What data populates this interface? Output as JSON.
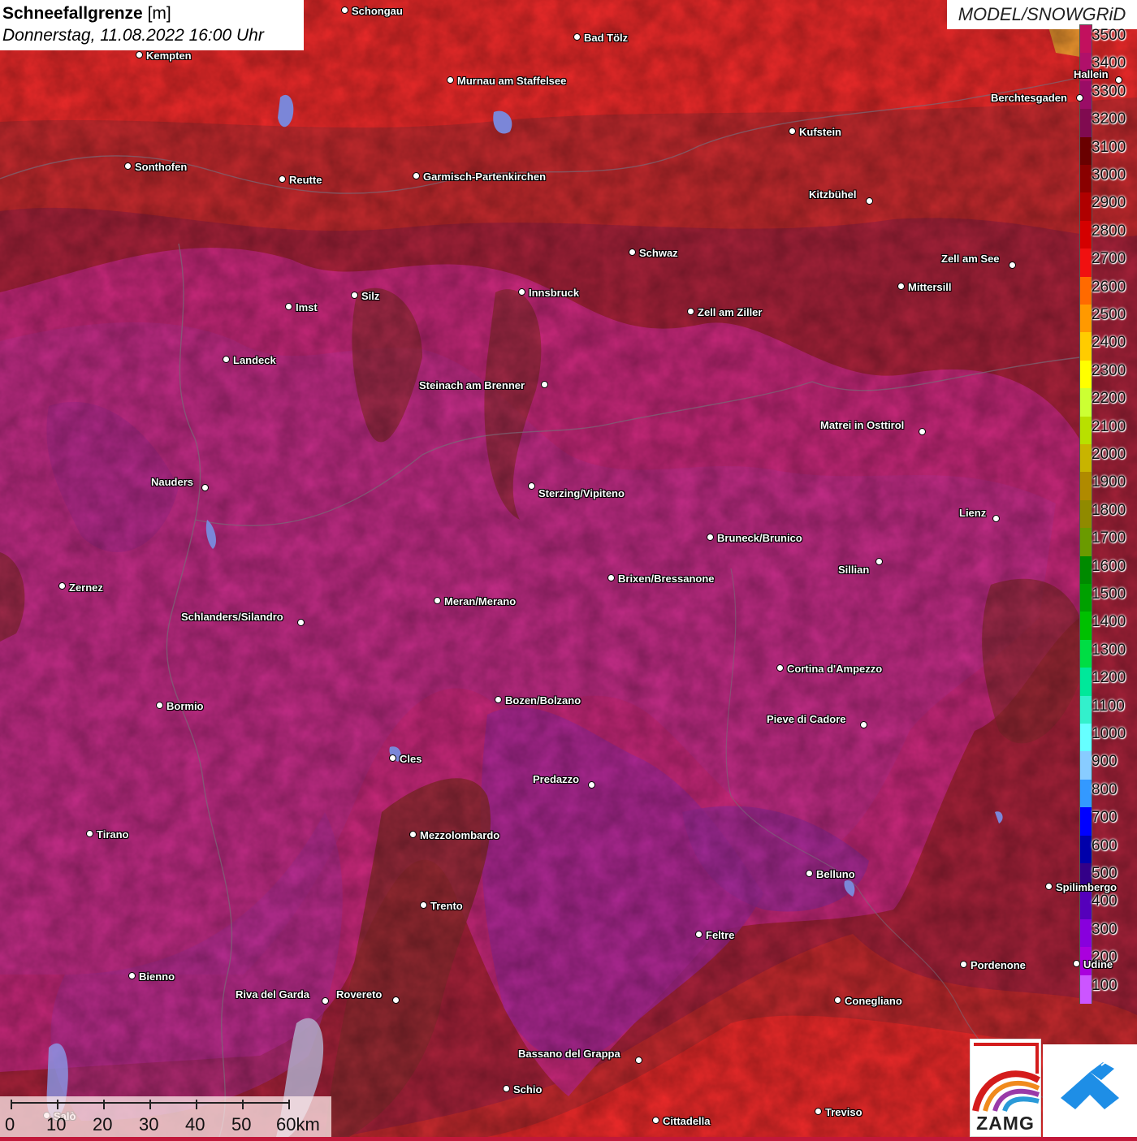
{
  "title": {
    "main": "Schneefallgrenze",
    "unit": "[m]",
    "date": "Donnerstag, 11.08.2022 16:00 Uhr"
  },
  "model_label": "MODEL/SNOWGRiD",
  "legend": {
    "levels": [
      "3500",
      "3400",
      "3300",
      "3200",
      "3100",
      "3000",
      "2900",
      "2800",
      "2700",
      "2600",
      "2500",
      "2400",
      "2300",
      "2200",
      "2100",
      "2000",
      "1900",
      "1800",
      "1700",
      "1600",
      "1500",
      "1400",
      "1300",
      "1200",
      "1100",
      "1000",
      "900",
      "800",
      "700",
      "600",
      "500",
      "400",
      "300",
      "200",
      "100"
    ],
    "colors": [
      "#c2105e",
      "#b0106a",
      "#9a0c66",
      "#800a50",
      "#6a0000",
      "#8a0000",
      "#b00000",
      "#d40000",
      "#f01010",
      "#ff6a00",
      "#ff9900",
      "#ffcc00",
      "#ffff00",
      "#ccff33",
      "#b8e000",
      "#c8b400",
      "#b08a00",
      "#908a00",
      "#6a9a00",
      "#008a00",
      "#00a000",
      "#00c000",
      "#00dd44",
      "#00e89a",
      "#33f0cc",
      "#66ffff",
      "#88ccff",
      "#3399ff",
      "#0000ff",
      "#0000aa",
      "#330088",
      "#5500bb",
      "#8800dd",
      "#aa00dd",
      "#cc55ff"
    ]
  },
  "cities": [
    {
      "name": "Schongau"
    },
    {
      "name": "Bad Tölz"
    },
    {
      "name": "Kempten"
    },
    {
      "name": "Murnau am Staffelsee"
    },
    {
      "name": "Kufstein"
    },
    {
      "name": "Berchtesgaden"
    },
    {
      "name": "Sonthofen"
    },
    {
      "name": "Reutte"
    },
    {
      "name": "Garmisch-Partenkirchen"
    },
    {
      "name": "Kitzbühel"
    },
    {
      "name": "Schwaz"
    },
    {
      "name": "Zell am See"
    },
    {
      "name": "Mittersill"
    },
    {
      "name": "Innsbruck"
    },
    {
      "name": "Silz"
    },
    {
      "name": "Imst"
    },
    {
      "name": "Zell am Ziller"
    },
    {
      "name": "Landeck"
    },
    {
      "name": "Steinach am Brenner"
    },
    {
      "name": "Matrei in Osttirol"
    },
    {
      "name": "Nauders"
    },
    {
      "name": "Sterzing/Vipiteno"
    },
    {
      "name": "Lienz"
    },
    {
      "name": "Bruneck/Brunico"
    },
    {
      "name": "Sillian"
    },
    {
      "name": "Brixen/Bressanone"
    },
    {
      "name": "Zernez"
    },
    {
      "name": "Meran/Merano"
    },
    {
      "name": "Schlanders/Silandro"
    },
    {
      "name": "Cortina d'Ampezzo"
    },
    {
      "name": "Bozen/Bolzano"
    },
    {
      "name": "Bormio"
    },
    {
      "name": "Pieve di Cadore"
    },
    {
      "name": "Cles"
    },
    {
      "name": "Predazzo"
    },
    {
      "name": "Tirano"
    },
    {
      "name": "Mezzolombardo"
    },
    {
      "name": "Belluno"
    },
    {
      "name": "Spilimbergo"
    },
    {
      "name": "Trento"
    },
    {
      "name": "Feltre"
    },
    {
      "name": "Pordenone"
    },
    {
      "name": "Bienno"
    },
    {
      "name": "Riva del Garda"
    },
    {
      "name": "Rovereto"
    },
    {
      "name": "Conegliano"
    },
    {
      "name": "Bassano del Grappa"
    },
    {
      "name": "Schio"
    },
    {
      "name": "Treviso"
    },
    {
      "name": "Cittadella"
    },
    {
      "name": "Hallein"
    },
    {
      "name": "Udine"
    },
    {
      "name": "Salò"
    }
  ],
  "scale": {
    "labels": [
      "0",
      "10",
      "20",
      "30",
      "40",
      "50",
      "60km"
    ]
  },
  "logos": {
    "zamg": "ZAMG"
  }
}
